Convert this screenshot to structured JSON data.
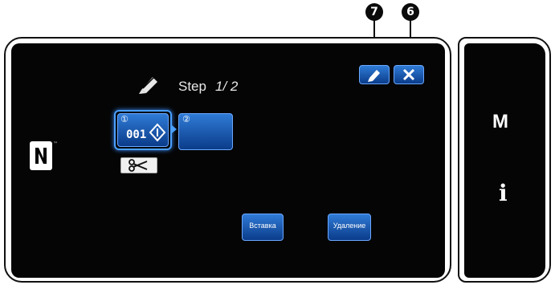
{
  "callouts": {
    "edit_marker": "7",
    "close_marker": "6"
  },
  "header": {
    "step_label": "Step",
    "step_value": "1/ 2"
  },
  "steps": [
    {
      "index": "①",
      "code": "001",
      "selected": true
    },
    {
      "index": "②",
      "code": "",
      "selected": false
    }
  ],
  "buttons": {
    "insert_label": "Вставка",
    "delete_label": "Удаление"
  },
  "side_panel": {
    "mode_label": "M",
    "info_label": "i"
  },
  "icons": {
    "edit": "pencil-icon",
    "close": "close-icon",
    "cut": "scissors-icon",
    "nfc": "nfc-icon",
    "header": "pencil-icon"
  },
  "colors": {
    "screen_bg": "#050505",
    "button_blue": "#1d5fb8",
    "button_border": "#6aa8ff"
  }
}
